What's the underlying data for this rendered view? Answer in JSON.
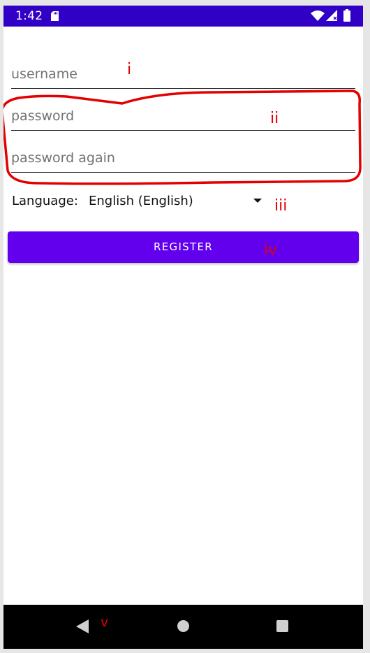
{
  "status_bar": {
    "time": "1:42",
    "background": "#3100c6",
    "icons": [
      "sd-card-icon",
      "wifi-icon",
      "signal-icon",
      "battery-icon"
    ]
  },
  "form": {
    "username_placeholder": "username",
    "password_placeholder": "password",
    "password_again_placeholder": "password again",
    "language_label": "Language:",
    "language_value": "English (English)",
    "register_label": "REGISTER",
    "accent_color": "#6200ee"
  },
  "annotations": {
    "color": "#e30000",
    "labels": {
      "i": "i",
      "ii": "ii",
      "iii": "iii",
      "iv": "iv",
      "v": "v"
    }
  },
  "nav_bar": {
    "icons": [
      "back-icon",
      "home-icon",
      "recent-apps-icon"
    ]
  }
}
